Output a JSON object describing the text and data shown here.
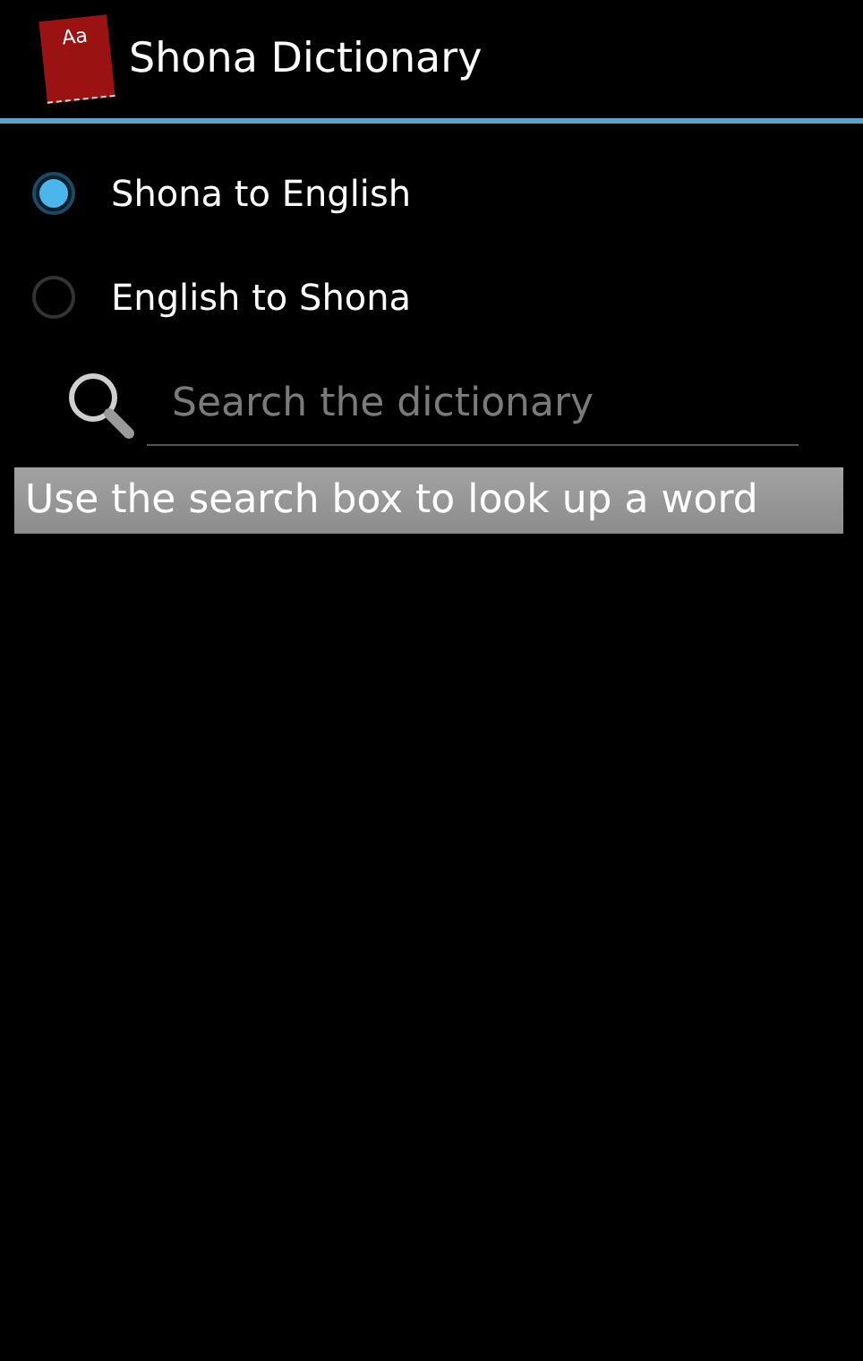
{
  "action_bar": {
    "app_icon_text": "Aa",
    "title": "Shona Dictionary"
  },
  "direction_options": [
    {
      "label": "Shona to English",
      "selected": true
    },
    {
      "label": "English to Shona",
      "selected": false
    }
  ],
  "search": {
    "placeholder": "Search the dictionary"
  },
  "hint": "Use the search box to look up a word"
}
